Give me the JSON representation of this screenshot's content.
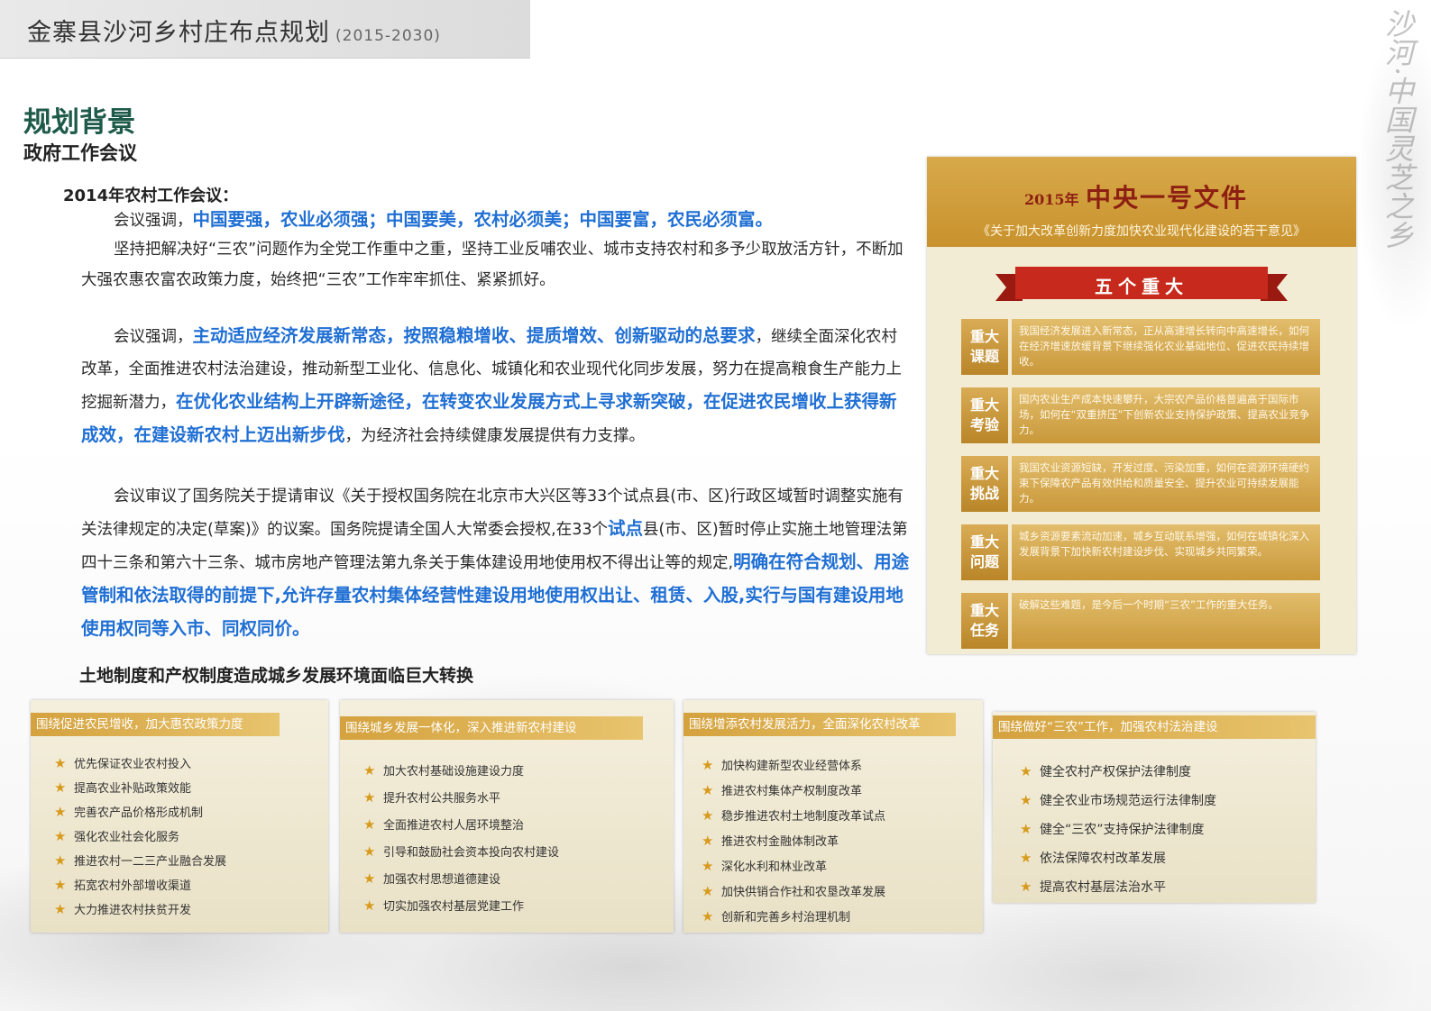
{
  "header": {
    "title": "金寨县沙河乡村庄布点规划",
    "years": "(2015-2030)"
  },
  "side_motto": "沙河·中国灵芝之乡",
  "section": {
    "title": "规划背景",
    "subtitle": "政府工作会议"
  },
  "meeting": {
    "title": "2014年农村工作会议：",
    "p1_intro": "会议强调，",
    "p1_hl": "中国要强，农业必须强；中国要美，农村必须美；中国要富，农民必须富。",
    "p2": "坚持把解决好“三农”问题作为全党工作重中之重，坚持工业反哺农业、城市支持农村和多予少取放活方针，不断加大强农惠农富农政策力度，始终把“三农”工作牢牢抓住、紧紧抓好。",
    "p3_a": "会议强调，",
    "p3_hl1": "主动适应经济发展新常态，按照稳粮增收、提质增效、创新驱动的总要求",
    "p3_b": "，继续全面深化农村改革，全面推进农村法治建设，推动新型工业化、信息化、城镇化和农业现代化同步发展，努力在提高粮食生产能力上挖掘新潜力，",
    "p3_hl2": "在优化农业结构上开辟新途径，在转变农业发展方式上寻求新突破，在促进农民增收上获得新成效，在建设新农村上迈出新步伐",
    "p3_c": "，为经济社会持续健康发展提供有力支撑。",
    "p4_a": "会议审议了国务院关于提请审议《关于授权国务院在北京市大兴区等33个试点县(市、区)行政区域暂时调整实施有关法律规定的决定(草案)》的议案。国务院提请全国人大常委会授权,在33个",
    "p4_hl1": "试点",
    "p4_b": "县(市、区)暂时停止实施土地管理法第四十三条和第六十三条、城市房地产管理法第九条关于集体建设用地使用权不得出让等的规定,",
    "p4_hl2": "明确在符合规划、用途管制和依法取得的前提下,允许存量农村集体经营性建设用地使用权出让、租赁、入股,实行与国有建设用地使用权同等入市、同权同价。"
  },
  "land_title": "土地制度和产权制度造成城乡发展环境面临巨大转换",
  "doc": {
    "year": "2015年",
    "name": "中央一号文件",
    "subtitle": "《关于加大改革创新力度加快农业现代化建设的若干意见》",
    "ribbon": "五个重大",
    "majors": [
      {
        "tag1": "重大",
        "tag2": "课题",
        "text": "我国经济发展进入新常态，正从高速增长转向中高速增长，如何在经济增速放缓背景下继续强化农业基础地位、促进农民持续增收。"
      },
      {
        "tag1": "重大",
        "tag2": "考验",
        "text": "国内农业生产成本快速攀升，大宗农产品价格普遍高于国际市场，如何在“双重挤压”下创新农业支持保护政策、提高农业竞争力。"
      },
      {
        "tag1": "重大",
        "tag2": "挑战",
        "text": "我国农业资源短缺，开发过度、污染加重，如何在资源环境硬约束下保障农产品有效供给和质量安全、提升农业可持续发展能力。"
      },
      {
        "tag1": "重大",
        "tag2": "问题",
        "text": "城乡资源要素流动加速，城乡互动联系增强，如何在城镇化深入发展背景下加快新农村建设步伐、实现城乡共同繁荣。"
      },
      {
        "tag1": "重大",
        "tag2": "任务",
        "text": "破解这些难题，是今后一个时期“三农”工作的重大任务。"
      }
    ]
  },
  "cards": [
    {
      "title": "围绕促进农民增收，加大惠农政策力度",
      "items": [
        "优先保证农业农村投入",
        "提高农业补贴政策效能",
        "完善农产品价格形成机制",
        "强化农业社会化服务",
        "推进农村一二三产业融合发展",
        "拓宽农村外部增收渠道",
        "大力推进农村扶贫开发"
      ]
    },
    {
      "title": "围绕城乡发展一体化，深入推进新农村建设",
      "items": [
        "加大农村基础设施建设力度",
        "提升农村公共服务水平",
        "全面推进农村人居环境整治",
        "引导和鼓励社会资本投向农村建设",
        "加强农村思想道德建设",
        "切实加强农村基层党建工作"
      ]
    },
    {
      "title": "围绕增添农村发展活力，全面深化农村改革",
      "items": [
        "加快构建新型农业经营体系",
        "推进农村集体产权制度改革",
        "稳步推进农村土地制度改革试点",
        "推进农村金融体制改革",
        "深化水利和林业改革",
        "加快供销合作社和农垦改革发展",
        "创新和完善乡村治理机制"
      ]
    },
    {
      "title": "围绕做好“三农”工作，加强农村法治建设",
      "items": [
        "健全农村产权保护法律制度",
        "健全农业市场规范运行法律制度",
        "健全“三农”支持保护法律制度",
        "依法保障农村改革发展",
        "提高农村基层法治水平"
      ]
    }
  ]
}
